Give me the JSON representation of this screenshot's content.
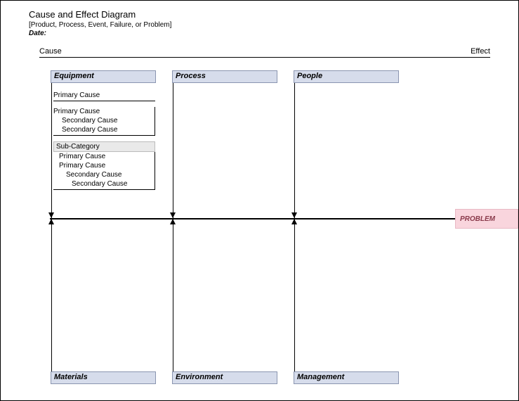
{
  "header": {
    "title": "Cause and Effect Diagram",
    "subtitle": "[Product, Process, Event, Failure, or Problem]",
    "date_label": "Date:"
  },
  "labels": {
    "cause": "Cause",
    "effect": "Effect"
  },
  "problem": "PROBLEM",
  "categories": {
    "top": [
      {
        "name": "Equipment"
      },
      {
        "name": "Process"
      },
      {
        "name": "People"
      }
    ],
    "bottom": [
      {
        "name": "Materials"
      },
      {
        "name": "Environment"
      },
      {
        "name": "Management"
      }
    ]
  },
  "equipment_causes": {
    "primary_solo": "Primary Cause",
    "block1": {
      "primary": "Primary Cause",
      "secondary1": "Secondary Cause",
      "secondary2": "Secondary Cause"
    },
    "subcat": {
      "label": "Sub-Category",
      "primary1": "Primary Cause",
      "primary2": "Primary Cause",
      "secondary": "Secondary Cause",
      "tertiary": "Secondary Cause"
    }
  }
}
